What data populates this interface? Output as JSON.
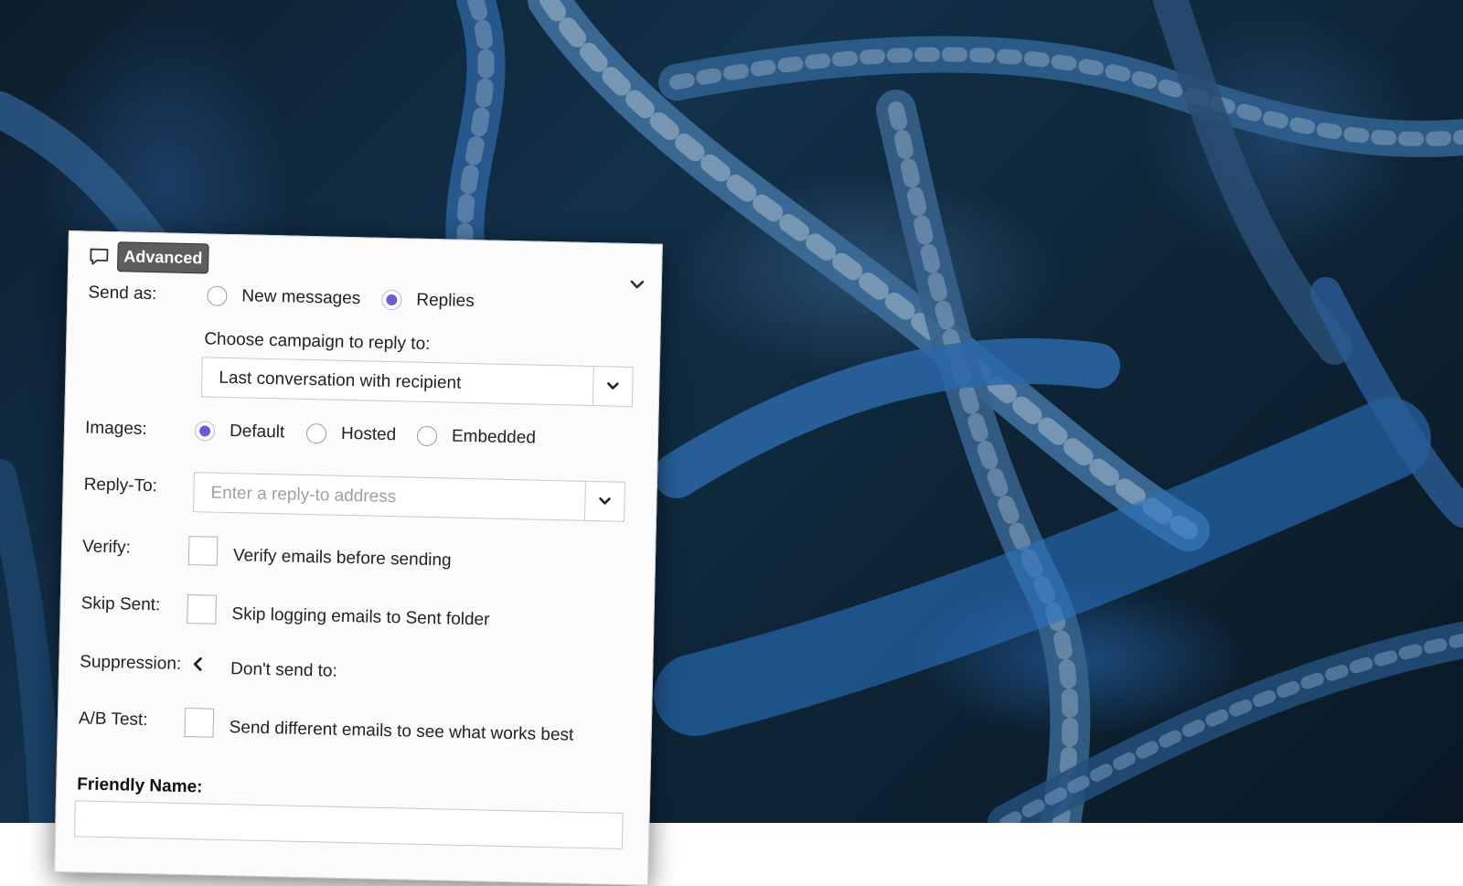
{
  "panel": {
    "tab_label": "Advanced",
    "send_as": {
      "label": "Send as:",
      "options": [
        {
          "label": "New messages",
          "checked": false
        },
        {
          "label": "Replies",
          "checked": true
        }
      ],
      "campaign_label": "Choose campaign to reply to:",
      "campaign_value": "Last conversation with recipient"
    },
    "images": {
      "label": "Images:",
      "options": [
        {
          "label": "Default",
          "checked": true
        },
        {
          "label": "Hosted",
          "checked": false
        },
        {
          "label": "Embedded",
          "checked": false
        }
      ]
    },
    "reply_to": {
      "label": "Reply-To:",
      "placeholder": "Enter a reply-to address"
    },
    "verify": {
      "label": "Verify:",
      "text": "Verify emails before sending",
      "checked": false
    },
    "skip_sent": {
      "label": "Skip Sent:",
      "text": "Skip logging emails to Sent folder",
      "checked": false
    },
    "suppression": {
      "label": "Suppression:",
      "text": "Don't send to:"
    },
    "ab_test": {
      "label": "A/B Test:",
      "text": "Send different emails to see what works best",
      "checked": false
    },
    "friendly_name": {
      "label": "Friendly Name:"
    }
  },
  "colors": {
    "accent": "#6b5bd6",
    "badge_bg": "#5d5d5d",
    "panel_bg": "#fbfbfb"
  },
  "icons": {
    "tab": "comment-icon",
    "collapse": "chevron-down-icon",
    "select": "chevron-down-icon",
    "suppression": "chevron-left-icon"
  }
}
